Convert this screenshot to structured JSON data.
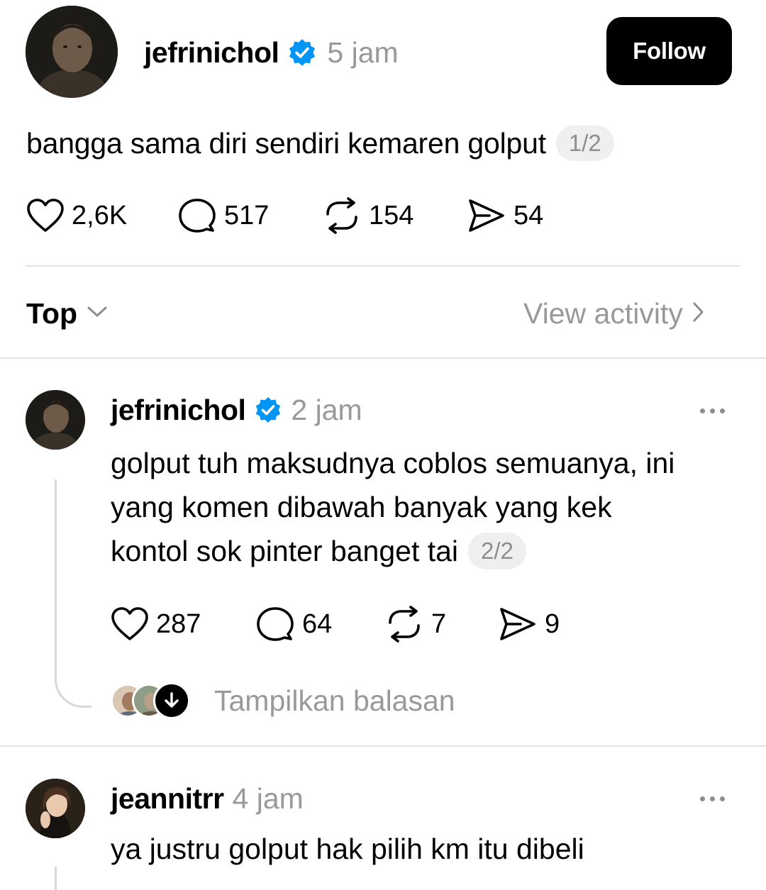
{
  "post": {
    "username": "jefrinichol",
    "time": "5 jam",
    "follow_label": "Follow",
    "text": "bangga sama diri sendiri kemaren golput",
    "counter": "1/2",
    "likes": "2,6K",
    "comments": "517",
    "reposts": "154",
    "shares": "54"
  },
  "sort": {
    "label": "Top",
    "view_activity": "View activity"
  },
  "replies": [
    {
      "username": "jefrinichol",
      "time": "2 jam",
      "verified": true,
      "lines": [
        "golput tuh maksudnya coblos semuanya, ini",
        "yang komen dibawah banyak yang kek",
        "kontol sok pinter banget tai"
      ],
      "counter": "2/2",
      "likes": "287",
      "comments": "64",
      "reposts": "7",
      "shares": "9",
      "show_replies": "Tampilkan balasan"
    },
    {
      "username": "jeannitrr",
      "time": "4 jam",
      "verified": false,
      "text": "ya justru golput hak pilih km itu dibeli"
    }
  ],
  "colors": {
    "verified_blue": "#0095f6",
    "muted": "#999999"
  }
}
